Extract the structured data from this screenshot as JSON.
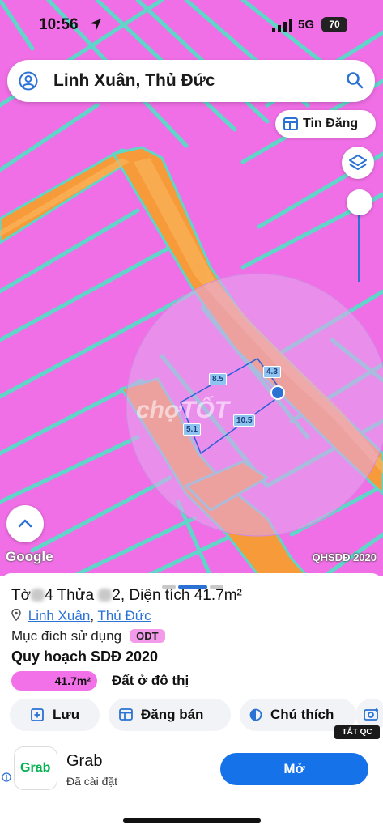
{
  "status_bar": {
    "time": "10:56",
    "network": "5G",
    "battery": "70"
  },
  "search": {
    "query": "Linh Xuân, Thủ Đức"
  },
  "map": {
    "tin_dang_label": "Tin Đăng",
    "google_label": "Google",
    "layer_label": "QHSDĐ 2020",
    "watermark": "chợTỐT",
    "dimensions": [
      "8.5",
      "4.3",
      "10.5",
      "5.1"
    ],
    "colors": {
      "residential": "#f06fe6",
      "road": "#f79a3a",
      "boundary": "#5fd6c8"
    }
  },
  "panel": {
    "sheet_prefix": "Tờ",
    "sheet_suffix": "4 Thửa",
    "plot_suffix": "2, Diện tích 41.7m²",
    "ward_link": "Linh Xuân",
    "separator": ",",
    "district_link": "Thủ Đức",
    "purpose_label": "Mục đích sử dụng",
    "purpose_code": "ODT",
    "plan_title": "Quy hoạch SDĐ 2020",
    "area_value": "41.7m²",
    "area_label": "Đất ở đô thị",
    "actions": {
      "save": "Lưu",
      "post": "Đăng bán",
      "legend": "Chú thích"
    }
  },
  "ad": {
    "badge": "TẮT QC",
    "logo_text": "Grab",
    "app_name": "Grab",
    "subtitle": "Đã cài đặt",
    "open_label": "Mở"
  }
}
